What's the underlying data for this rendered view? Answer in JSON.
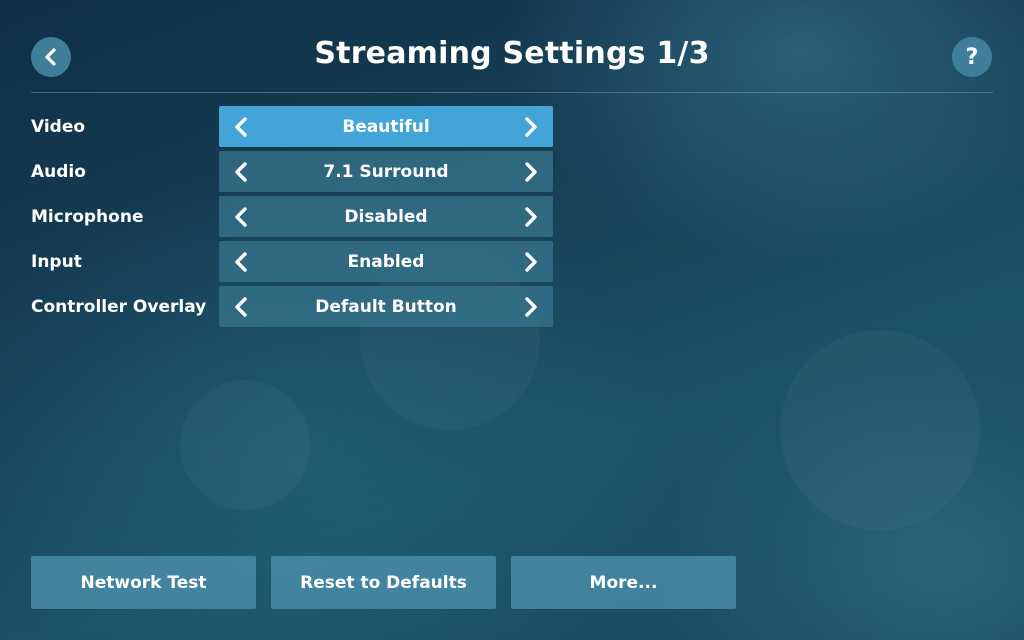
{
  "header": {
    "title": "Streaming Settings 1/3",
    "back_icon": "chevron-left-icon",
    "help_label": "?"
  },
  "settings": [
    {
      "label": "Video",
      "value": "Beautiful",
      "active": true
    },
    {
      "label": "Audio",
      "value": "7.1 Surround",
      "active": false
    },
    {
      "label": "Microphone",
      "value": "Disabled",
      "active": false
    },
    {
      "label": "Input",
      "value": "Enabled",
      "active": false
    },
    {
      "label": "Controller Overlay",
      "value": "Default Button",
      "active": false
    }
  ],
  "buttons": {
    "network_test": "Network Test",
    "reset_defaults": "Reset to Defaults",
    "more": "More..."
  },
  "colors": {
    "selector_active": "#43a4d8",
    "selector": "#37738c",
    "round_button": "#3f7f9c"
  }
}
